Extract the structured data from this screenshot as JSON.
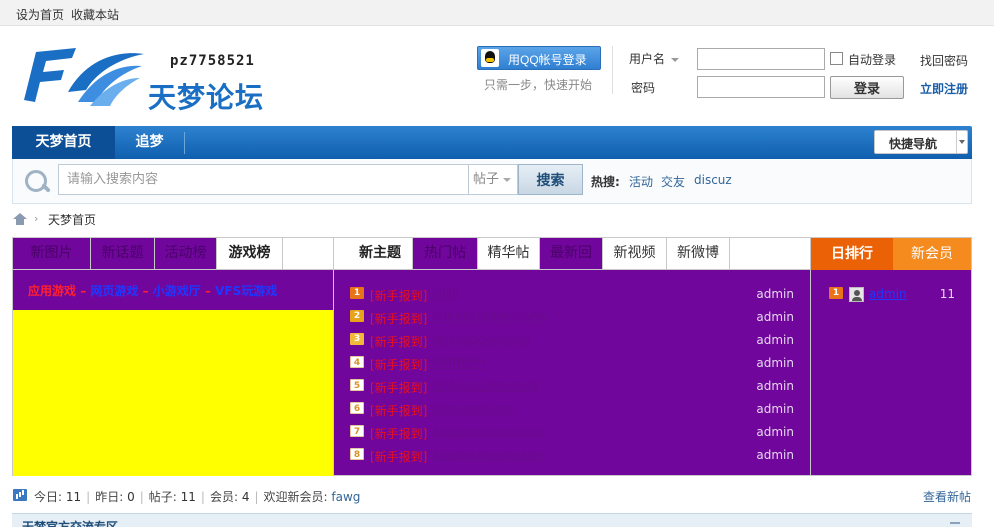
{
  "topbar": {
    "set_home": "设为首页",
    "bookmark": "收藏本站"
  },
  "logo": {
    "user_id": "pz7758521",
    "site_name": "天梦论坛"
  },
  "qq_login": {
    "button": "用QQ帐号登录",
    "tip": "只需一步，快速开始"
  },
  "login": {
    "username_label": "用户名",
    "password_label": "密码",
    "username_value": "",
    "password_value": "",
    "auto_login": "自动登录",
    "login_button": "登录",
    "forgot_password": "找回密码",
    "register": "立即注册"
  },
  "nav": {
    "tabs": [
      {
        "label": "天梦首页"
      },
      {
        "label": "追梦"
      }
    ],
    "quick_nav": "快捷导航"
  },
  "search": {
    "placeholder": "请输入搜索内容",
    "value": "",
    "type": "帖子",
    "button": "搜索",
    "hot_label": "热搜:",
    "hot_links": [
      "活动",
      "交友",
      "discuz"
    ]
  },
  "breadcrumb": {
    "separator": "›",
    "current": "天梦首页"
  },
  "left_panel": {
    "tabs": [
      "新图片",
      "新话题",
      "活动榜",
      "游戏榜"
    ],
    "game_links": [
      "应用游戏",
      "网页游戏",
      "小游戏厅",
      "VFS玩游戏"
    ],
    "link_separator": " – "
  },
  "mid_panel": {
    "tabs": [
      "新主题",
      "热门帖",
      "精华帖",
      "最新回",
      "新视频",
      "新微博"
    ],
    "threads": [
      {
        "rank": "1",
        "tag": "[新手报到]",
        "title": "jjjjjjjj",
        "author": "admin"
      },
      {
        "rank": "2",
        "tag": "[新手报到]",
        "title": "hhhhhhhhhhhhhhh",
        "author": "admin"
      },
      {
        "rank": "3",
        "tag": "[新手报到]",
        "title": "ggggggggggggg",
        "author": "admin"
      },
      {
        "rank": "4",
        "tag": "[新手报到]",
        "title": "fffffffffffff",
        "author": "admin"
      },
      {
        "rank": "5",
        "tag": "[新手报到]",
        "title": "dddddddddddddd",
        "author": "admin"
      },
      {
        "rank": "6",
        "tag": "[新手报到]",
        "title": "sssssssssssss",
        "author": "admin"
      },
      {
        "rank": "7",
        "tag": "[新手报到]",
        "title": "aaaaaaaaaaaaaaa",
        "author": "admin"
      },
      {
        "rank": "8",
        "tag": "[新手报到]",
        "title": "aaaaaaaaaaaaaaa",
        "author": "admin"
      }
    ]
  },
  "rank_panel": {
    "tabs": [
      "日排行",
      "新会员"
    ],
    "entries": [
      {
        "rank": "1",
        "name": "admin",
        "count": "11"
      }
    ]
  },
  "stats": {
    "today_label": "今日:",
    "today": "11",
    "yesterday_label": "昨日:",
    "yesterday": "0",
    "posts_label": "帖子:",
    "posts": "11",
    "members_label": "会员:",
    "members": "4",
    "welcome_label": "欢迎新会员:",
    "newest_member": "fawg",
    "view_new": "查看新帖"
  },
  "section": {
    "title": "天梦官方交流专区"
  },
  "colors": {
    "nav_blue": "#1a6fc4",
    "panel_purple": "#70069b",
    "highlight_yellow": "#ffff00",
    "rank_orange": "#ea6205",
    "link_blue": "#336699",
    "tag_red": "#e8101d"
  }
}
